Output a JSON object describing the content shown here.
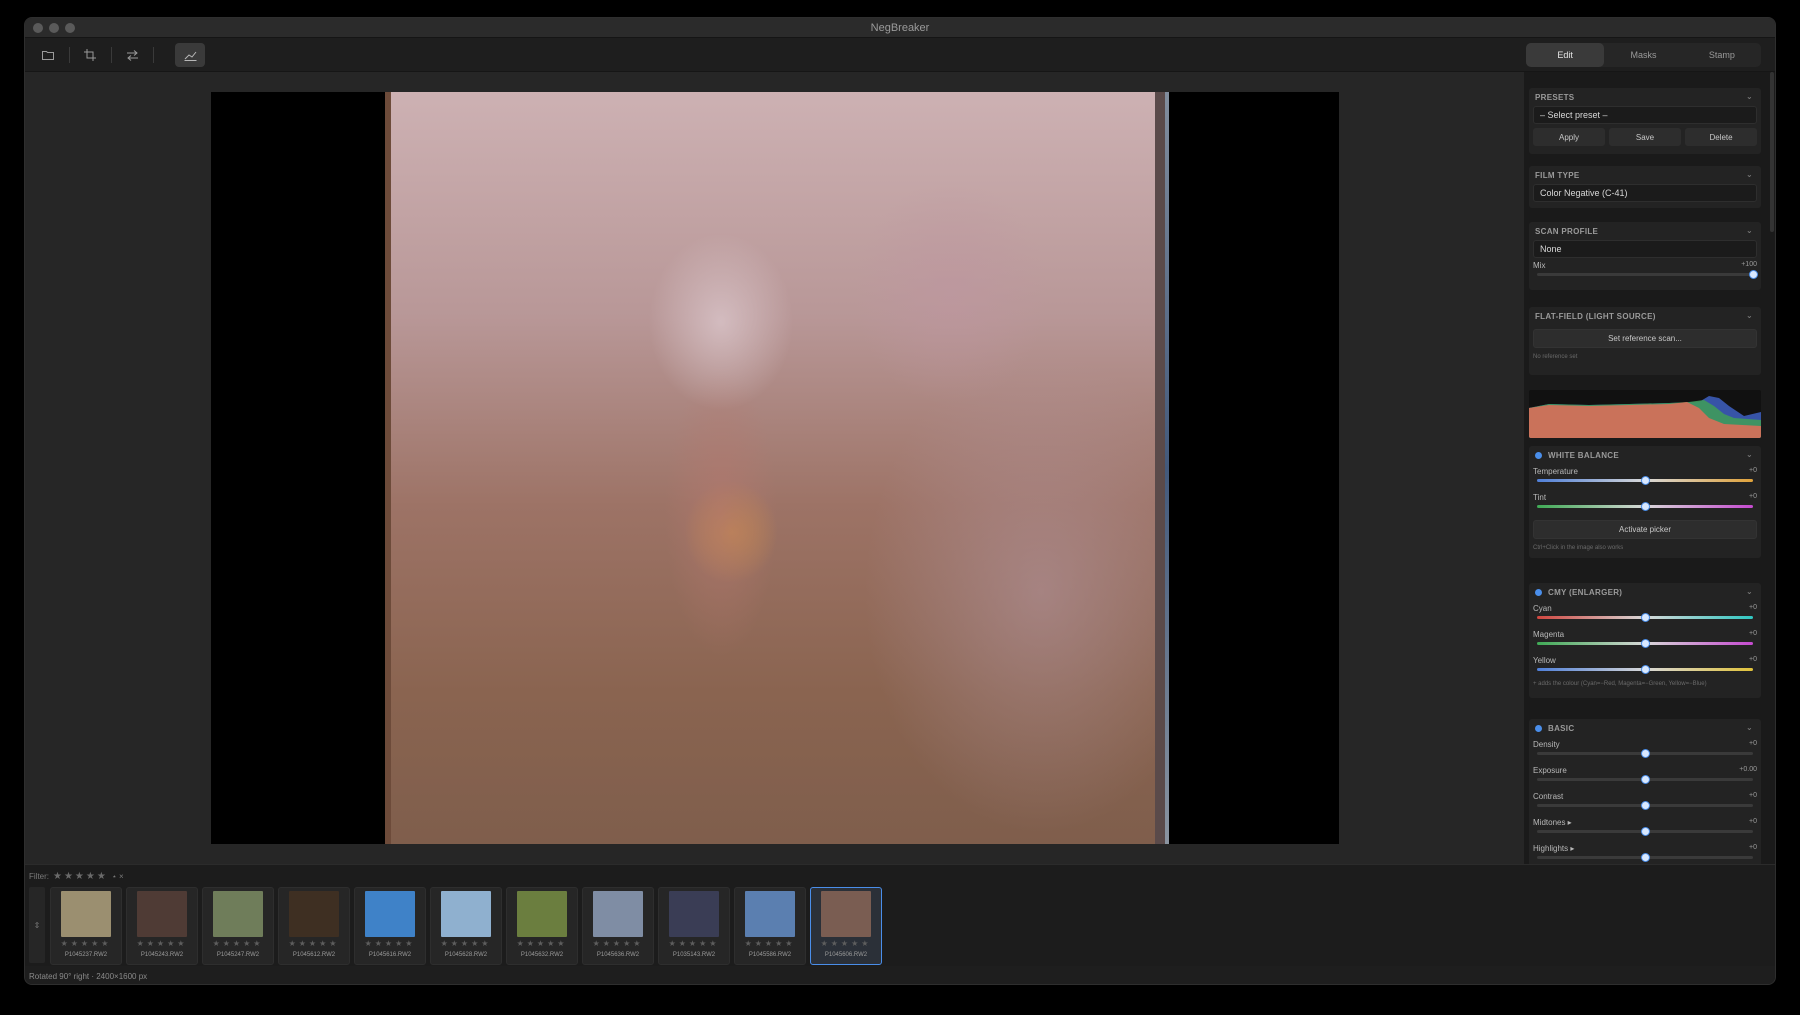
{
  "app": {
    "title": "NegBreaker"
  },
  "toolbar": {
    "tools": [
      {
        "name": "open-folder-icon"
      },
      {
        "name": "crop-icon"
      },
      {
        "name": "flip-icon"
      },
      {
        "name": "curves-icon"
      }
    ]
  },
  "tabs": [
    "Edit",
    "Masks",
    "Stamp"
  ],
  "panel": {
    "presets": {
      "title": "PRESETS",
      "select_value": "– Select preset –",
      "apply": "Apply",
      "save": "Save",
      "delete": "Delete"
    },
    "film_type": {
      "title": "FILM TYPE",
      "value": "Color Negative (C-41)"
    },
    "scan_profile": {
      "title": "SCAN PROFILE",
      "value": "None",
      "mix_label": "Mix",
      "mix_value": "+100",
      "mix_level": 1.0
    },
    "flat_field": {
      "title": "FLAT-FIELD (LIGHT SOURCE)",
      "button": "Set reference scan...",
      "note": "No reference set"
    },
    "white_balance": {
      "title": "WHITE BALANCE",
      "temperature_label": "Temperature",
      "temperature_value": "+0",
      "tint_label": "Tint",
      "tint_value": "+0",
      "picker": "Activate picker",
      "note": "Ctrl+Click in the image also works"
    },
    "cmy": {
      "title": "CMY (ENLARGER)",
      "cyan_label": "Cyan",
      "cyan_value": "+0",
      "magenta_label": "Magenta",
      "magenta_value": "+0",
      "yellow_label": "Yellow",
      "yellow_value": "+0",
      "note": "+ adds the colour (Cyan=−Red, Magenta=−Green, Yellow=−Blue)"
    },
    "basic": {
      "title": "BASIC",
      "density_label": "Density",
      "density_value": "+0",
      "exposure_label": "Exposure",
      "exposure_value": "+0.00",
      "contrast_label": "Contrast",
      "contrast_value": "+0",
      "midtones_label": "Midtones ▸",
      "midtones_value": "+0",
      "highlights_label": "Highlights ▸",
      "highlights_value": "+0"
    }
  },
  "filmstrip": {
    "filter_label": "Filter:",
    "filter_stars": "★★★★★",
    "filter_extra": "⋆  ×",
    "rating_stars": "★★★★★",
    "files": [
      "P1045237.RW2",
      "P1045243.RW2",
      "P1045247.RW2",
      "P1045612.RW2",
      "P1045616.RW2",
      "P1045628.RW2",
      "P1045632.RW2",
      "P1045636.RW2",
      "P1035143.RW2",
      "P1045586.RW2",
      "P1045606.RW2"
    ],
    "thumb_colors": [
      "#9b8f70",
      "#4f3b35",
      "#6f7d5a",
      "#3e2f22",
      "#3f82c8",
      "#8fb0cf",
      "#6b7e3f",
      "#7f8da4",
      "#3a3d55",
      "#5b7fb0",
      "#7a5d52"
    ],
    "selected_index": 10
  },
  "status": {
    "text": "Rotated 90° right · 2400×1600 px"
  },
  "colors": {
    "accent": "#4a8eea"
  }
}
